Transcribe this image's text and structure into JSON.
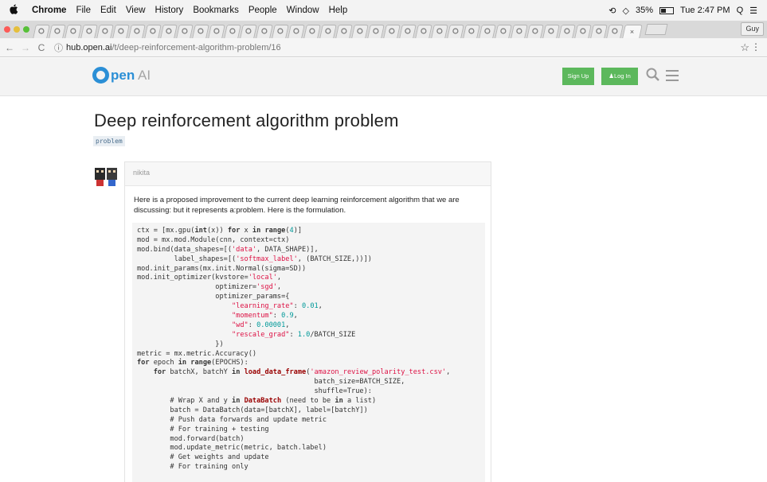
{
  "menubar": {
    "apple": "",
    "items": [
      "Chrome",
      "File",
      "Edit",
      "View",
      "History",
      "Bookmarks",
      "People",
      "Window",
      "Help"
    ],
    "status": {
      "time_machine": "⟲",
      "wifi": "◇",
      "battery_pct": "35%",
      "datetime": "Tue 2:47 PM",
      "search": "Q",
      "list": "☰"
    }
  },
  "tabs": {
    "count": 38,
    "active_close": "×",
    "profile": "Guy"
  },
  "toolbar": {
    "back": "←",
    "forward": "→",
    "reload": "C",
    "info": "ⓘ",
    "url_host": "hub.open.ai",
    "url_path": "/t/deep-reinforcement-algorithm-problem/16",
    "star": "☆",
    "menu": "⋮"
  },
  "header": {
    "logo_pen": "pen",
    "logo_ai": " AI",
    "signup": "Sign Up",
    "login": "Log In",
    "login_icon": "♟"
  },
  "topic": {
    "title": "Deep reinforcement algorithm problem",
    "tag": "problem"
  },
  "post": {
    "username": "nikita",
    "text": "Here is a proposed improvement to the current deep learning reinforcement algorithm that we are discussing: but it represents a:problem. Here is the formulation."
  },
  "colors": {
    "brand_blue": "#2b8fd6",
    "button_green": "#5cb85c",
    "string_red": "#d14",
    "number_teal": "#099"
  }
}
